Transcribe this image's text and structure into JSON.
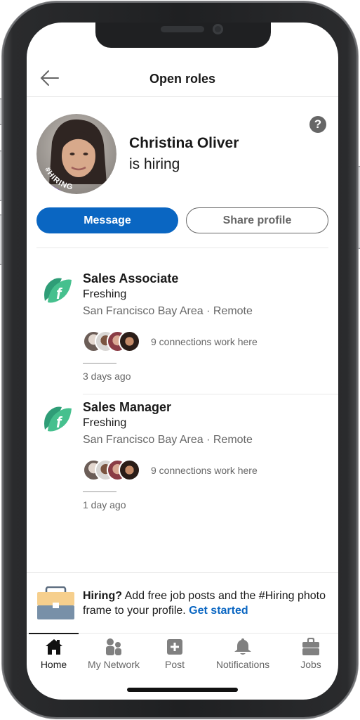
{
  "header": {
    "title": "Open roles",
    "back_icon": "arrow-left-icon"
  },
  "profile": {
    "name": "Christina Oliver",
    "subtitle": "is hiring",
    "frame_label": "#HIRING",
    "frame_color": "#7b3fe4",
    "help_icon": "?"
  },
  "actions": {
    "message_label": "Message",
    "share_label": "Share profile",
    "primary_color": "#0a66c2"
  },
  "jobs": [
    {
      "title": "Sales Associate",
      "company": "Freshing",
      "location": "San Francisco Bay Area · Remote",
      "connections": "9 connections work here",
      "posted": "3 days ago"
    },
    {
      "title": "Sales Manager",
      "company": "Freshing",
      "location": "San Francisco Bay Area · Remote",
      "connections": "9 connections work here",
      "posted": "1 day ago"
    }
  ],
  "banner": {
    "bold": "Hiring?",
    "text": " Add free job posts and the #Hiring photo frame to your profile. ",
    "link": "Get started"
  },
  "nav": {
    "active": "Home",
    "items": [
      {
        "label": "Home",
        "icon": "home-icon"
      },
      {
        "label": "My Network",
        "icon": "network-icon"
      },
      {
        "label": "Post",
        "icon": "post-icon"
      },
      {
        "label": "Notifications",
        "icon": "bell-icon"
      },
      {
        "label": "Jobs",
        "icon": "briefcase-icon"
      }
    ]
  }
}
